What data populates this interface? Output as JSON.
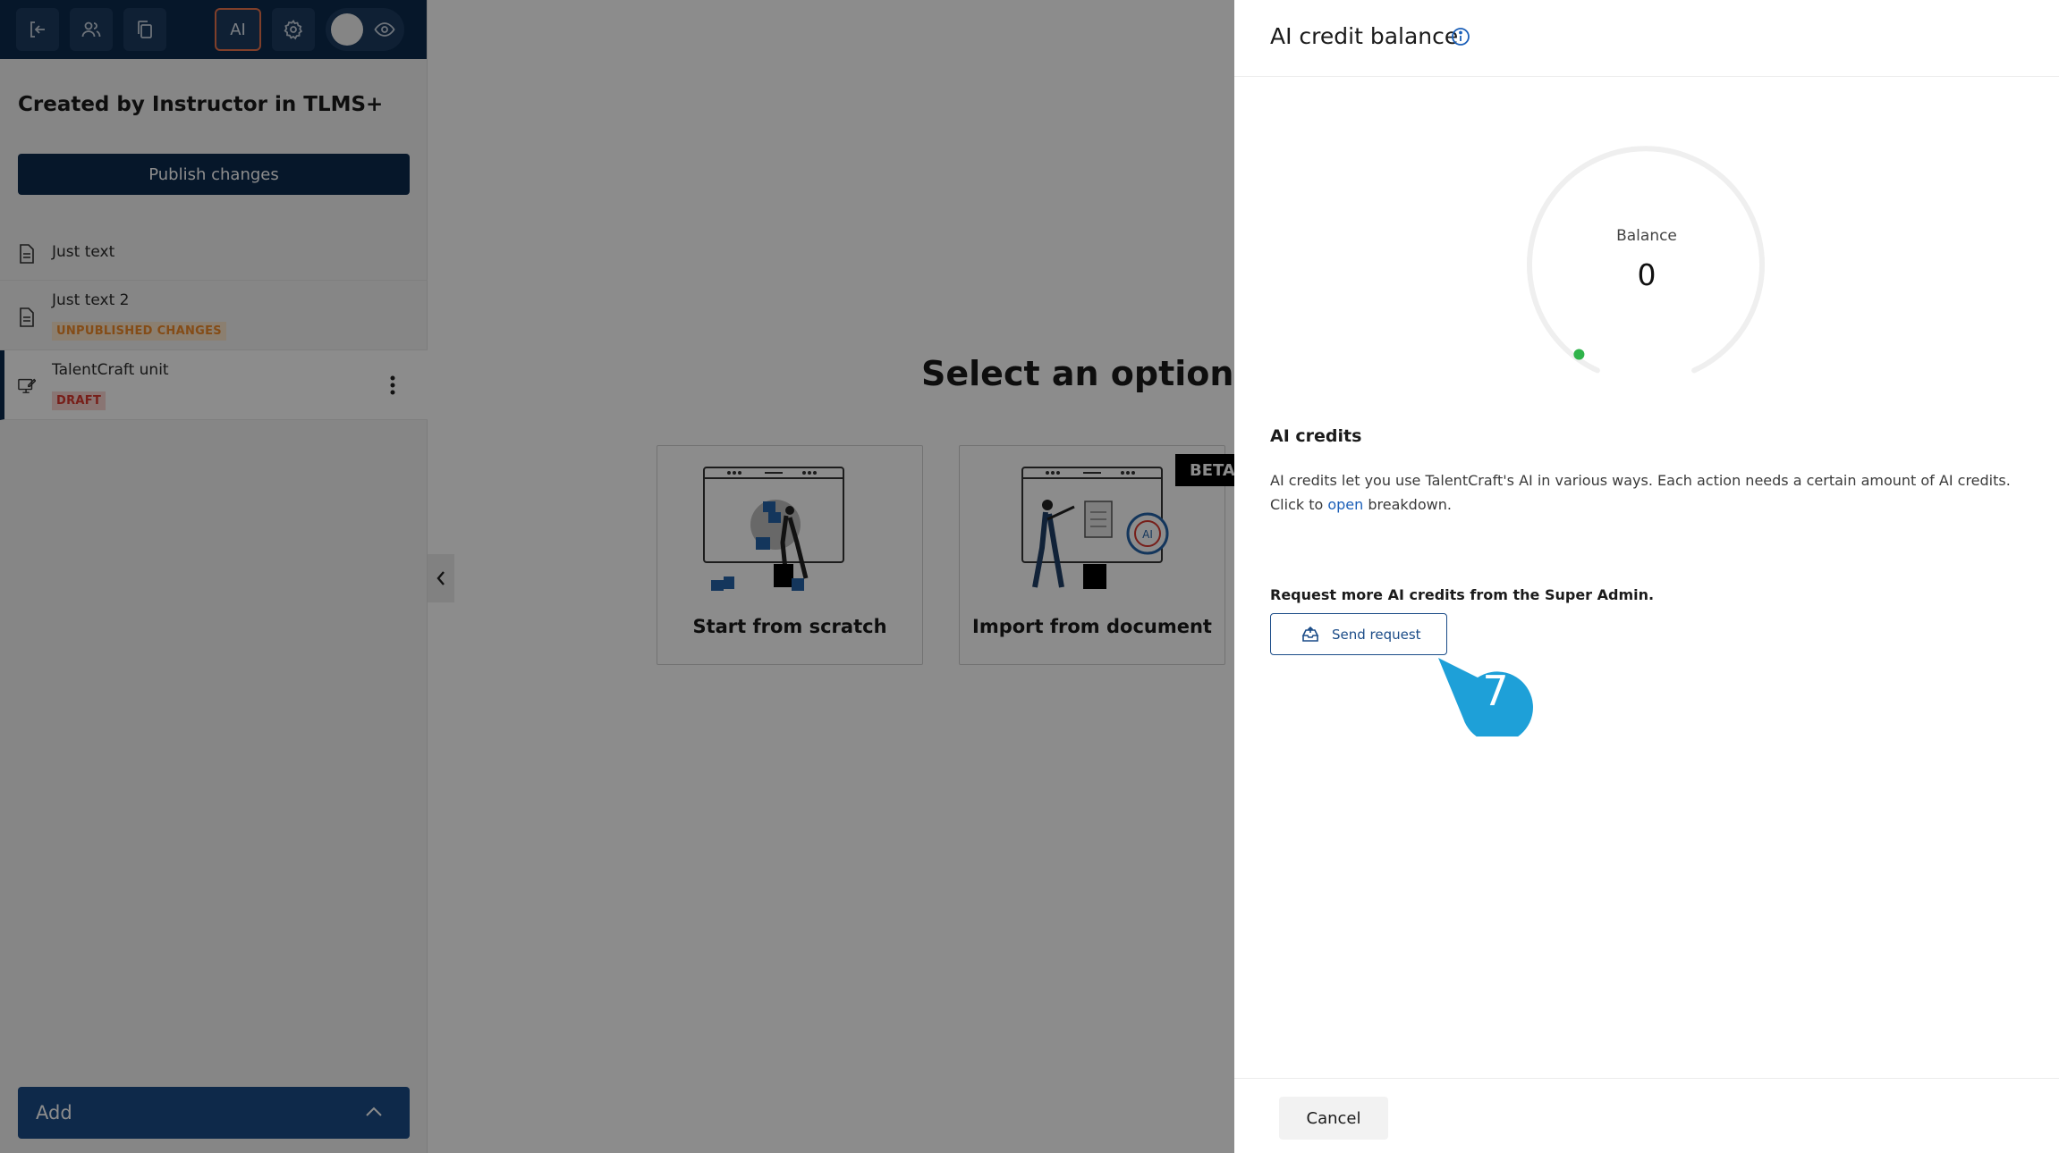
{
  "toolbar": {
    "ai_label": "AI"
  },
  "sidebar": {
    "course_title": "Created by Instructor in TLMS+",
    "publish_label": "Publish changes",
    "units": [
      {
        "label": "Just text",
        "badge": ""
      },
      {
        "label": "Just text 2",
        "badge": "UNPUBLISHED CHANGES"
      },
      {
        "label": "TalentCraft unit",
        "badge": "DRAFT"
      }
    ],
    "add_label": "Add"
  },
  "main": {
    "heading": "Select an option to",
    "options": [
      {
        "label": "Start from scratch"
      },
      {
        "label": "Import from document"
      }
    ],
    "beta_label": "BETA"
  },
  "drawer": {
    "title": "AI credit balance",
    "gauge": {
      "label": "Balance",
      "value": "0",
      "level": 0
    },
    "section_title": "AI credits",
    "description_before": "AI credits let you use TalentCraft's AI in various ways. Each action needs a certain amount of AI credits. Click to ",
    "description_link": "open",
    "description_after": " breakdown.",
    "request_title": "Request more AI credits from the Super Admin.",
    "send_label": "Send request",
    "cancel_label": "Cancel"
  },
  "step_callout": "7",
  "colors": {
    "navy": "#0c2a4e",
    "accent_blue": "#1b4c88",
    "callout": "#1ea0d8",
    "gauge_dot": "#2fb34a"
  }
}
